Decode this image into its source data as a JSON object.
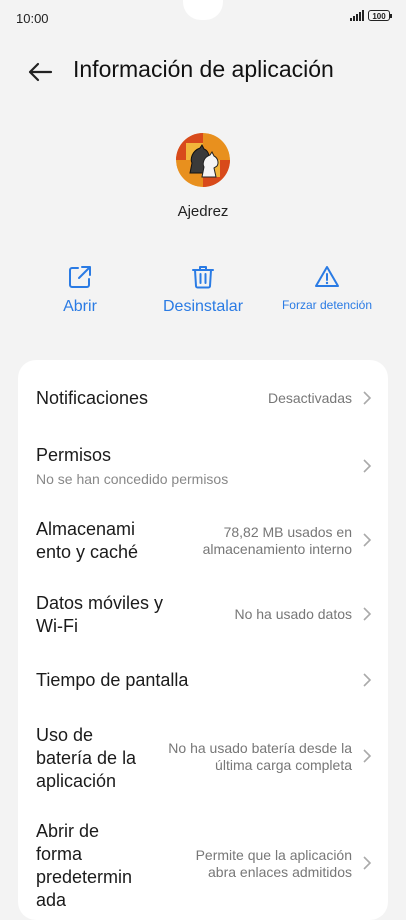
{
  "status": {
    "time": "10:00",
    "battery": "100"
  },
  "header": {
    "title": "Información de aplicación"
  },
  "app": {
    "name": "Ajedrez"
  },
  "actions": [
    {
      "label": "Abrir",
      "icon": "open-external-icon"
    },
    {
      "label": "Desinstalar",
      "icon": "trash-icon"
    },
    {
      "label": "Forzar detención",
      "icon": "warning-icon"
    }
  ],
  "settings": {
    "notifications": {
      "label": "Notificaciones",
      "value": "Desactivadas"
    },
    "permissions": {
      "label": "Permisos",
      "sub": "No se han concedido permisos"
    },
    "storage": {
      "label_line1": "Almacenami",
      "label_line2": "ento y caché",
      "value_line1": "78,82 MB usados en",
      "value_line2": "almacenamiento interno"
    },
    "mobile_data": {
      "label_line1": "Datos móviles y",
      "label_line2": "Wi-Fi",
      "value": "No ha usado datos"
    },
    "screen_time": {
      "label": "Tiempo de pantalla"
    },
    "battery": {
      "label_line1": "Uso de",
      "label_line2": "batería de la",
      "label_line3": "aplicación",
      "value_line1": "No ha usado batería desde la",
      "value_line2": "última carga completa"
    },
    "open_default": {
      "label_line1": "Abrir de",
      "label_line2": "forma",
      "label_line3": "predetermin",
      "label_line4": "ada",
      "value_line1": "Permite que la aplicación",
      "value_line2": "abra enlaces admitidos"
    }
  },
  "colors": {
    "accent": "#2a7be4",
    "background": "#f3f3f3",
    "card": "#ffffff"
  }
}
